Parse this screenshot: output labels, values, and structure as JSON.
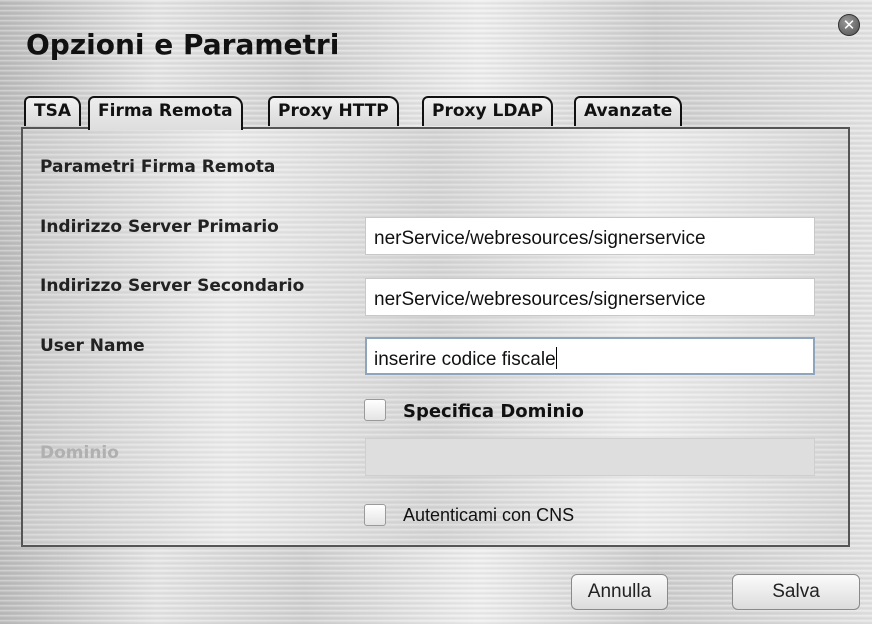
{
  "dialog": {
    "title": "Opzioni e Parametri",
    "close_icon": "close-icon"
  },
  "tabs": [
    {
      "label": "TSA",
      "active": false
    },
    {
      "label": "Firma Remota",
      "active": true
    },
    {
      "label": "Proxy HTTP",
      "active": false
    },
    {
      "label": "Proxy LDAP",
      "active": false
    },
    {
      "label": "Avanzate",
      "active": false
    }
  ],
  "panel": {
    "section_title": "Parametri Firma Remota",
    "primary_server": {
      "label": "Indirizzo Server Primario",
      "value": "nerService/webresources/signerservice"
    },
    "secondary_server": {
      "label": "Indirizzo Server Secondario",
      "value": "nerService/webresources/signerservice"
    },
    "user_name": {
      "label": "User Name",
      "value": "inserire codice fiscale"
    },
    "specify_domain": {
      "label": "Specifica Dominio",
      "checked": false
    },
    "domain": {
      "label": "Dominio",
      "value": "",
      "disabled": true
    },
    "cns_auth": {
      "label": "Autenticami con CNS",
      "checked": false
    }
  },
  "buttons": {
    "cancel": "Annulla",
    "save": "Salva"
  }
}
